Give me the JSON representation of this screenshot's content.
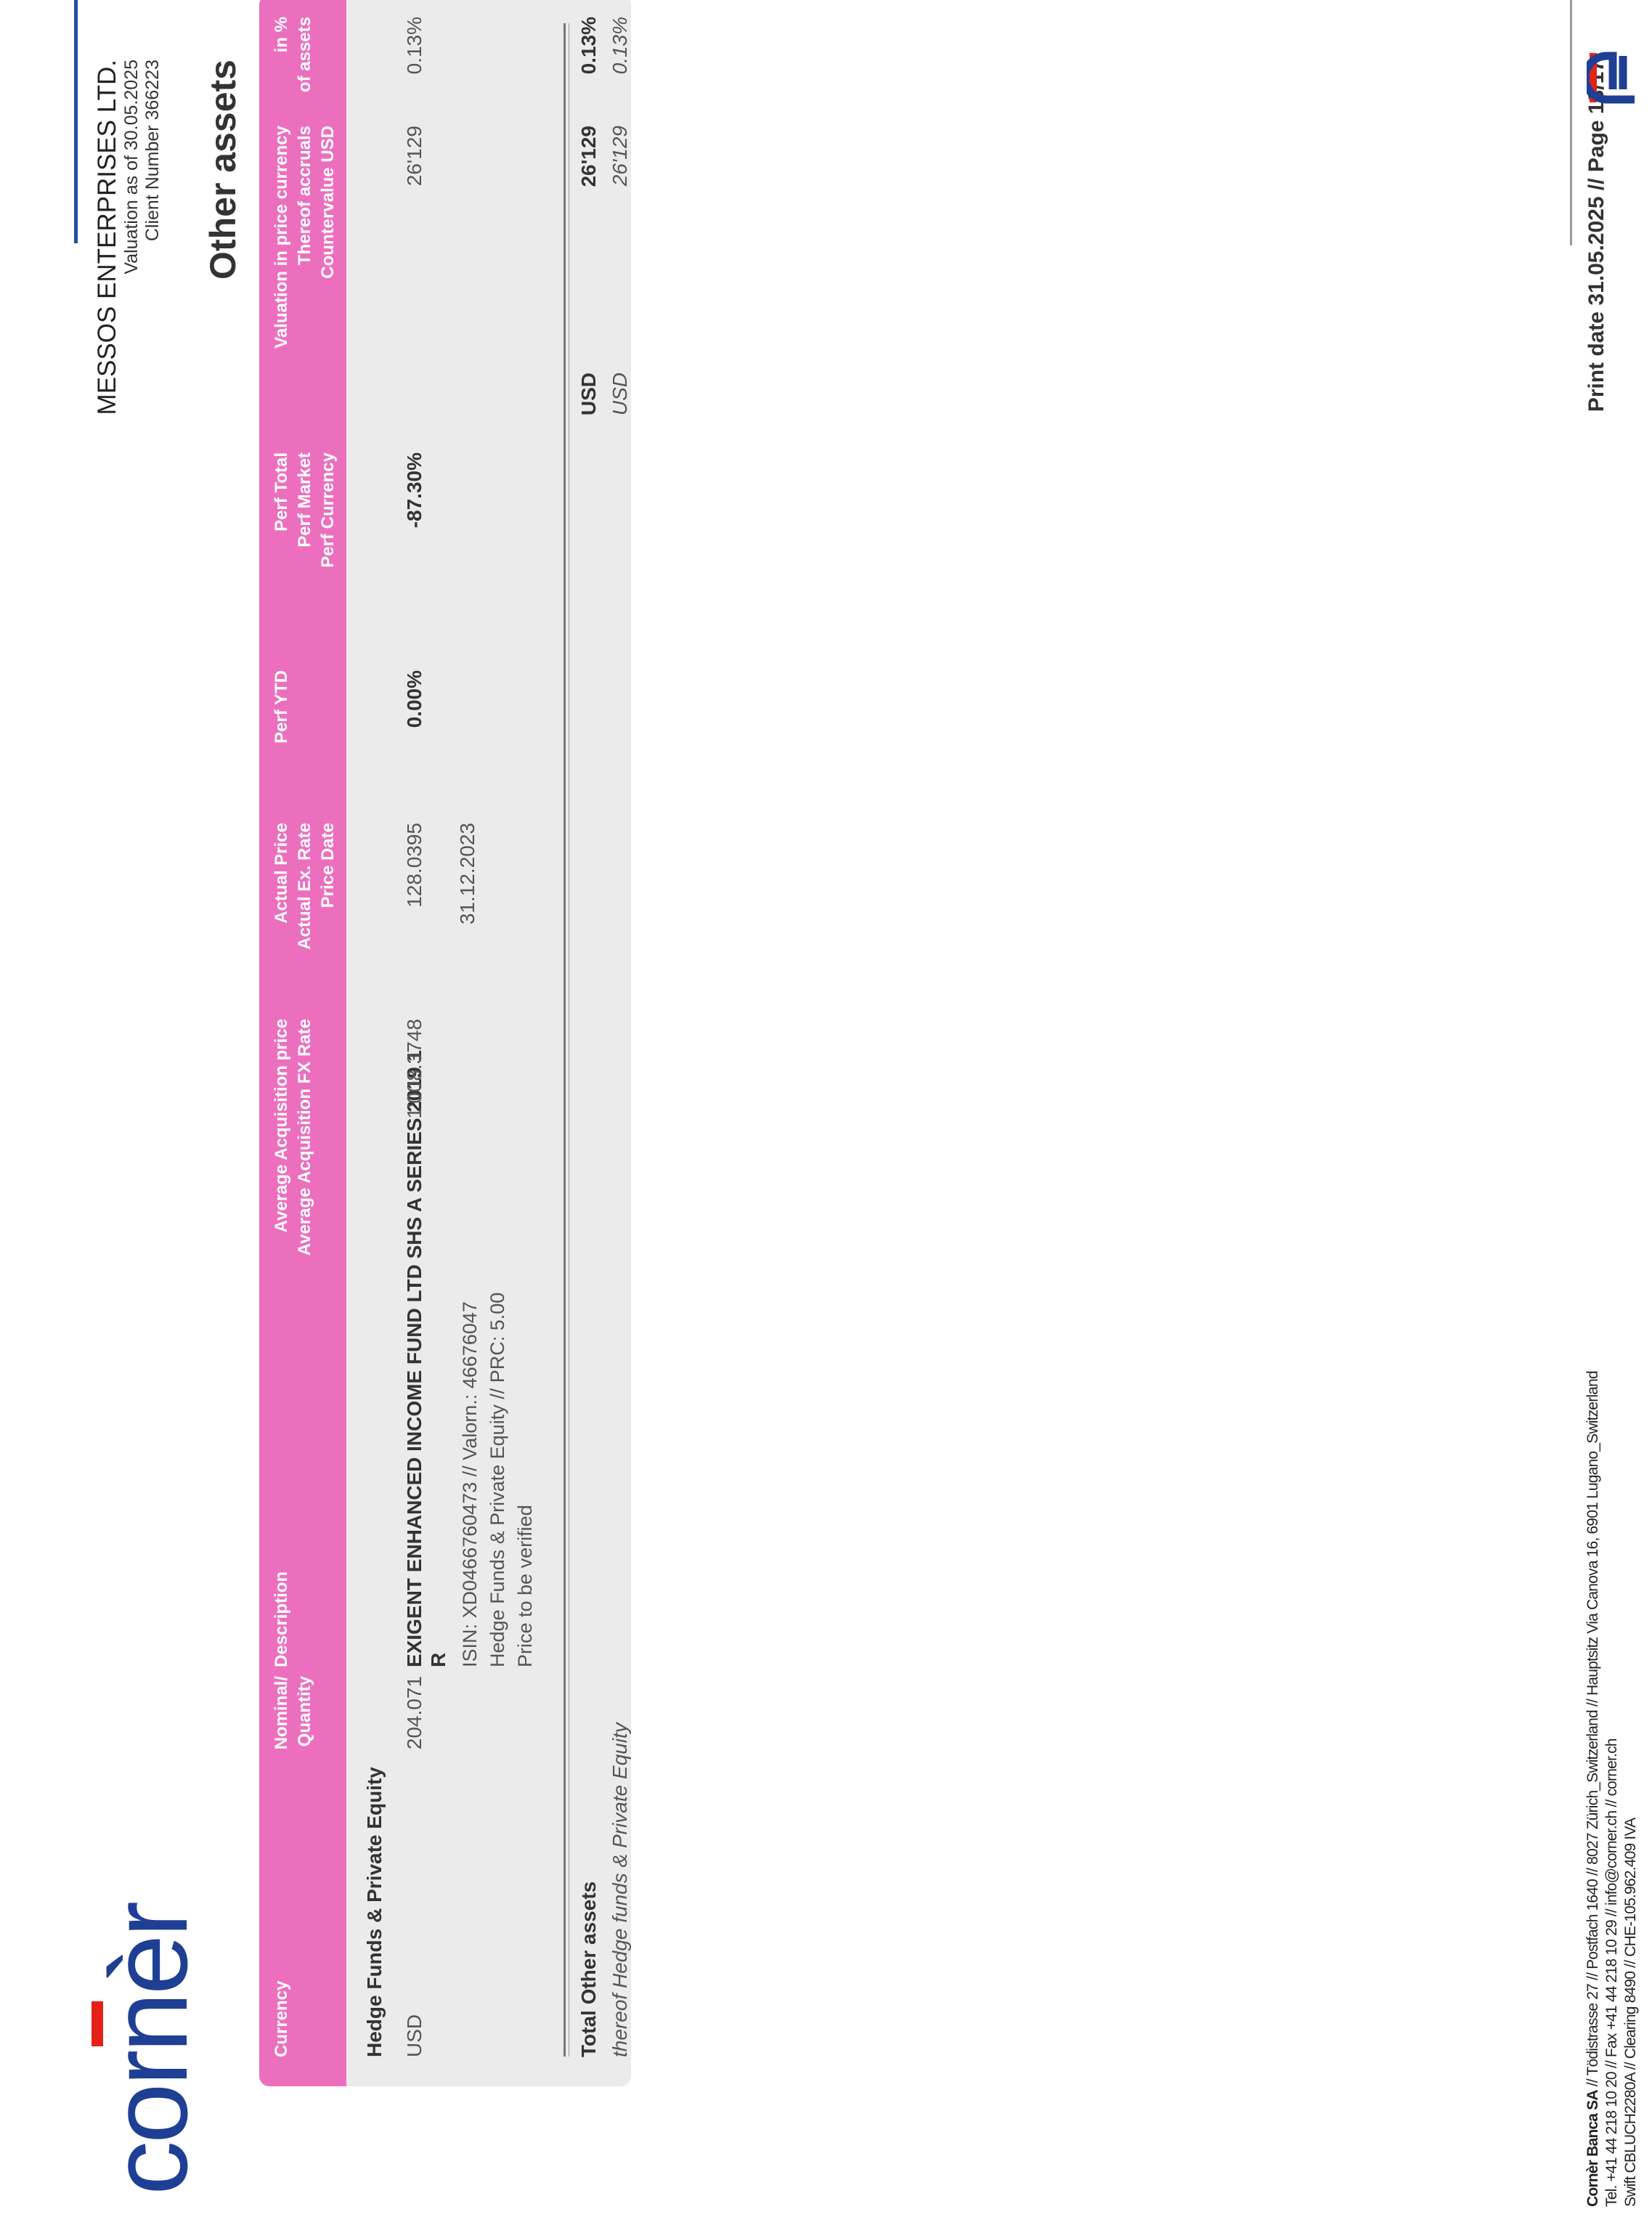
{
  "brand": {
    "logo_text": "cornèr"
  },
  "header": {
    "client_name": "MESSOS ENTERPRISES LTD.",
    "valuation_as_of": "Valuation as of 30.05.2025",
    "client_number": "Client Number 366223",
    "section_title": "Other assets"
  },
  "table": {
    "columns": {
      "currency": "Currency",
      "nominal_1": "Nominal/",
      "nominal_2": "Quantity",
      "description": "Description",
      "avg_acq_1": "Average Acquisition price",
      "avg_acq_2": "Average Acquisition FX Rate",
      "actual_1": "Actual Price",
      "actual_2": "Actual Ex. Rate",
      "actual_3": "Price Date",
      "perf_ytd": "Perf YTD",
      "perf_total_1": "Perf Total",
      "perf_total_2": "Perf Market",
      "perf_total_3": "Perf Currency",
      "valuation_1": "Valuation in price currency",
      "valuation_2": "Thereof accruals",
      "valuation_3": "Countervalue USD",
      "pct_1": "in %",
      "pct_2": "of assets"
    },
    "group_title": "Hedge Funds & Private Equity",
    "row": {
      "currency": "USD",
      "quantity": "204.071",
      "description_line1": "EXIGENT ENHANCED INCOME FUND LTD SHS A SERIES 2019 1",
      "description_line2": "R",
      "isin_line": "ISIN: XD0466760473  //  Valorn.: 46676047",
      "class_line": "Hedge Funds & Private Equity  //  PRC: 5.00",
      "note_line": "Price to be verified",
      "avg_acq_price": "1'008.3748",
      "actual_price": "128.0395",
      "price_date": "31.12.2023",
      "perf_ytd": "0.00%",
      "perf_total": "-87.30%",
      "valuation": "26'129",
      "pct_assets": "0.13%"
    },
    "total": {
      "label": "Total Other assets",
      "currency": "USD",
      "valuation": "26'129",
      "pct": "0.13%"
    },
    "thereof": {
      "label": "thereof Hedge funds & Private Equity",
      "currency": "USD",
      "valuation": "26'129",
      "pct": "0.13%"
    }
  },
  "print_info": "Print date 31.05.2025 // Page 13/17",
  "footer": {
    "line1_bold": "Cornèr Banca SA",
    "line1": " // Tödistrasse 27 // Postfach 1640 // 8027 Zürich_Switzerland // Hauptsitz Via Canova 16, 6901 Lugano_Switzerland",
    "line2": "Tel. +41 44 218 10 20 // Fax +41 44 218 10 29 // info@corner.ch // corner.ch",
    "line3": "Swift CBLUCH2280A // Clearing 8490 // CHE-105.962.409 IVA"
  },
  "colors": {
    "brand_blue": "#1f3f94",
    "brand_red": "#e32119",
    "header_pink": "#ec6fbe",
    "panel_gray": "#ebebeb"
  }
}
